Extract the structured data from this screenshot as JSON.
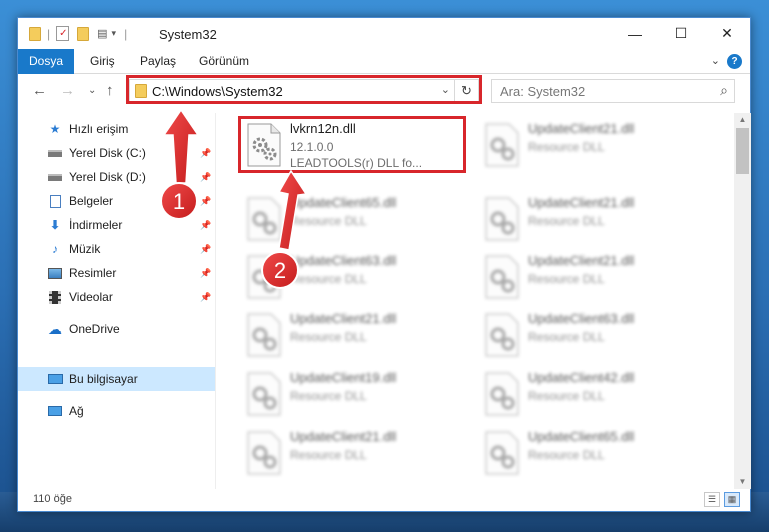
{
  "window": {
    "title": "System32",
    "controls": {
      "minimize": "—",
      "maximize": "☐",
      "close": "✕"
    }
  },
  "ribbon": {
    "tabs": [
      "Dosya",
      "Giriş",
      "Paylaş",
      "Görünüm"
    ],
    "expand_glyph": "⌄",
    "help": "?"
  },
  "nav": {
    "back": "←",
    "forward": "→",
    "recent": "⌄",
    "up": "↑",
    "address_path": "C:\\Windows\\System32",
    "address_dropdown": "⌄",
    "refresh": "↻",
    "search_placeholder": "Ara: System32",
    "search_icon": "⌕"
  },
  "sidebar": {
    "items": [
      {
        "label": "Hızlı erişim",
        "icon": "star-icon",
        "pinned": false
      },
      {
        "label": "Yerel Disk (C:)",
        "icon": "drive-icon",
        "pinned": true
      },
      {
        "label": "Yerel Disk (D:)",
        "icon": "drive-icon",
        "pinned": true
      },
      {
        "label": "Belgeler",
        "icon": "document-icon",
        "pinned": true
      },
      {
        "label": "İndirmeler",
        "icon": "download-icon",
        "pinned": true
      },
      {
        "label": "Müzik",
        "icon": "music-icon",
        "pinned": true
      },
      {
        "label": "Resimler",
        "icon": "pictures-icon",
        "pinned": true
      },
      {
        "label": "Videolar",
        "icon": "video-icon",
        "pinned": true
      },
      {
        "label": "OneDrive",
        "icon": "cloud-icon",
        "pinned": false
      },
      {
        "label": "Bu bilgisayar",
        "icon": "computer-icon",
        "pinned": false,
        "selected": true
      },
      {
        "label": "Ağ",
        "icon": "network-icon",
        "pinned": false
      }
    ],
    "pin_glyph": "📌"
  },
  "files": {
    "highlighted": {
      "name": "lvkrn12n.dll",
      "version": "12.1.0.0",
      "description": "LEADTOOLS(r) DLL fo..."
    },
    "left_column": [
      {
        "name": "UpdateClient65.dll",
        "type": "Resource DLL"
      },
      {
        "name": "UpdateClient63.dll",
        "type": "Resource DLL"
      },
      {
        "name": "UpdateClient21.dll",
        "type": "Resource DLL"
      },
      {
        "name": "UpdateClient19.dll",
        "type": "Resource DLL"
      },
      {
        "name": "UpdateClient21.dll",
        "type": "Resource DLL"
      }
    ],
    "right_column": [
      {
        "name": "UpdateClient21.dll",
        "type": "Resource DLL"
      },
      {
        "name": "UpdateClient21.dll",
        "type": "Resource DLL"
      },
      {
        "name": "UpdateClient21.dll",
        "type": "Resource DLL"
      },
      {
        "name": "UpdateClient63.dll",
        "type": "Resource DLL"
      },
      {
        "name": "UpdateClient42.dll",
        "type": "Resource DLL"
      },
      {
        "name": "UpdateClient65.dll",
        "type": "Resource DLL"
      }
    ]
  },
  "status": {
    "item_count": "110 öğe"
  },
  "annotations": {
    "step1": "1",
    "step2": "2",
    "highlight_color": "#d8262b"
  }
}
